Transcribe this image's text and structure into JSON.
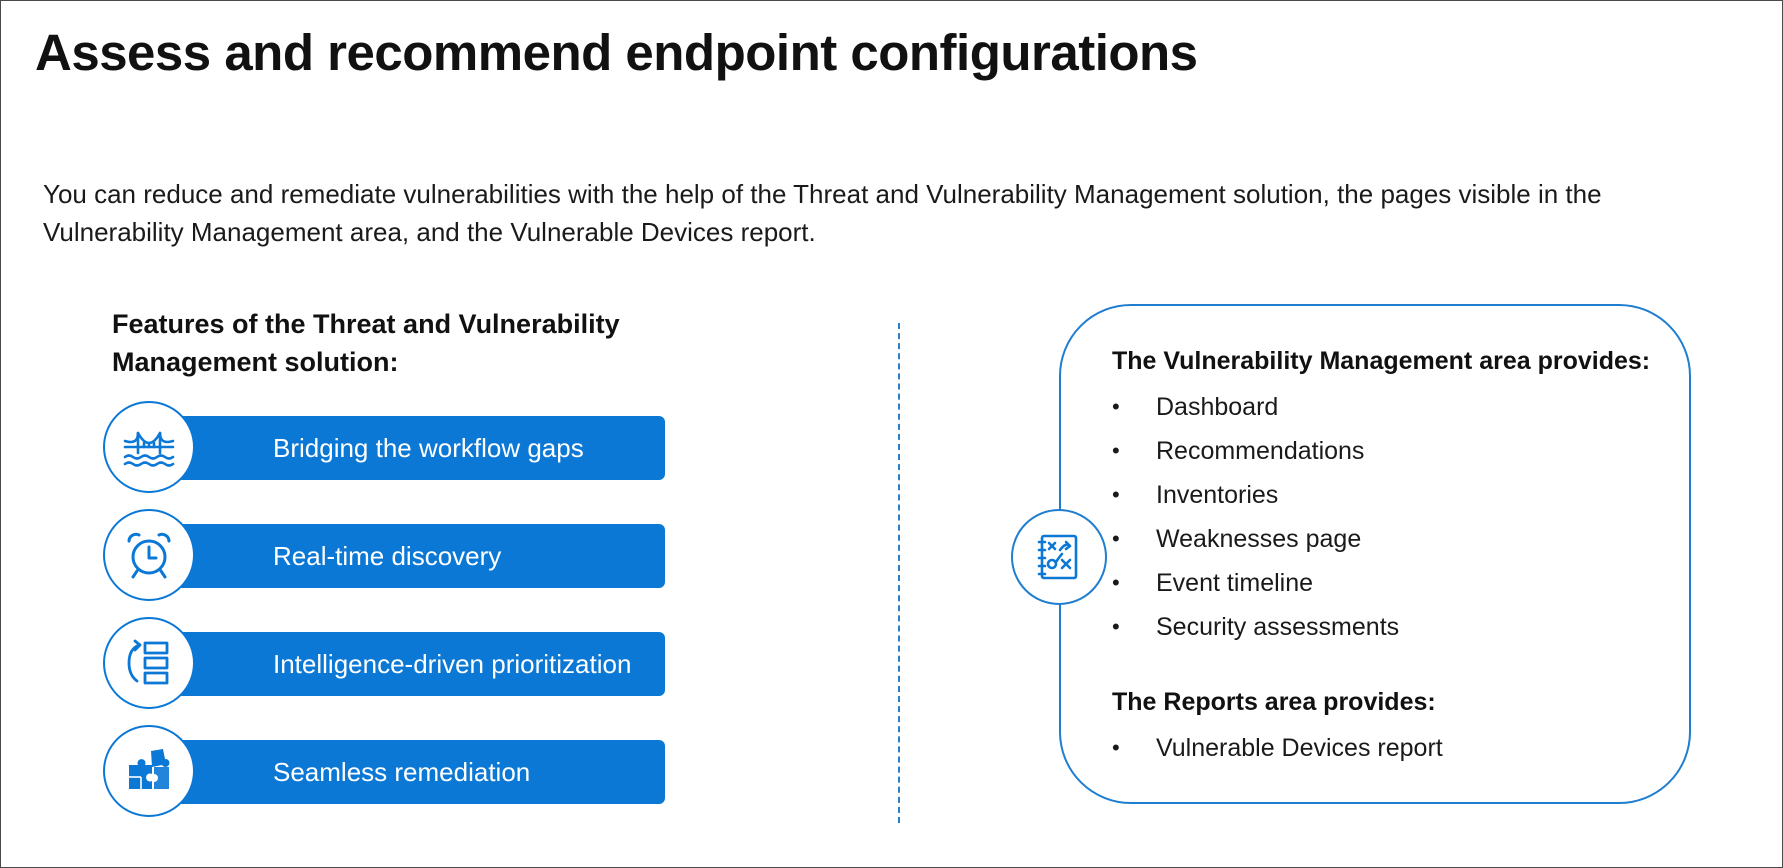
{
  "title": "Assess and recommend endpoint configurations",
  "intro": "You can reduce and remediate vulnerabilities with the help of the Threat and Vulnerability Management solution, the pages visible in the Vulnerability Management area, and the Vulnerable Devices report.",
  "features": {
    "heading": "Features of the Threat and Vulnerability Management solution:",
    "items": [
      {
        "label": "Bridging the workflow gaps",
        "icon": "bridge-icon"
      },
      {
        "label": "Real-time discovery",
        "icon": "alarm-clock-icon"
      },
      {
        "label": "Intelligence-driven prioritization",
        "icon": "prioritization-list-icon"
      },
      {
        "label": "Seamless remediation",
        "icon": "puzzle-icon"
      }
    ]
  },
  "vm_area": {
    "icon": "strategy-board-icon",
    "heading": "The Vulnerability Management area provides:",
    "items": [
      "Dashboard",
      "Recommendations",
      "Inventories",
      "Weaknesses page",
      "Event timeline",
      "Security assessments"
    ]
  },
  "reports_area": {
    "heading": "The Reports area provides:",
    "items": [
      "Vulnerable Devices report"
    ]
  },
  "bullet_char": "•",
  "colors": {
    "accent": "#0b78d6",
    "outline": "#1f7ed0",
    "text": "#111111"
  }
}
